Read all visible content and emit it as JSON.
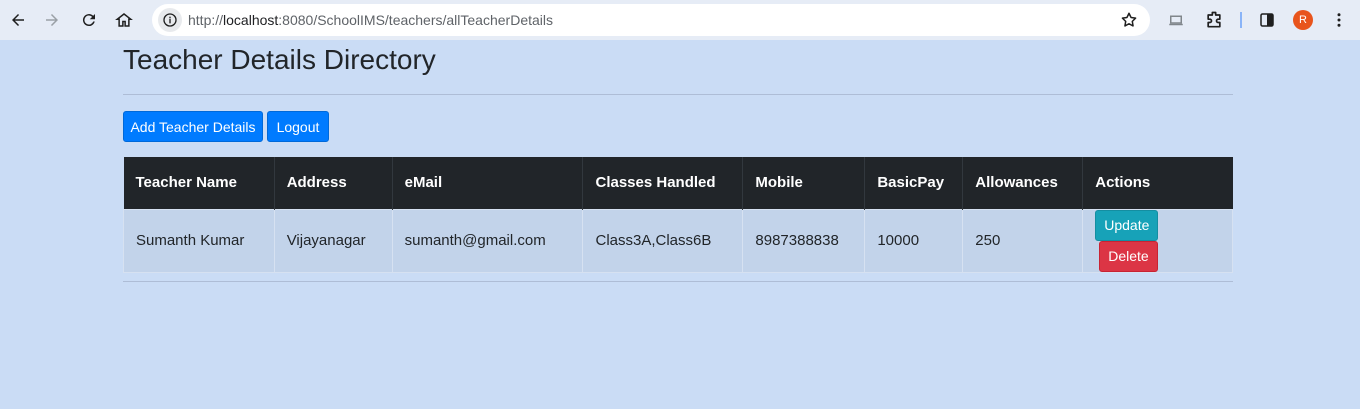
{
  "browser": {
    "url_prefix": "http://",
    "url_host": "localhost",
    "url_rest": ":8080/SchoolIMS/teachers/allTeacherDetails",
    "profile_initial": "R",
    "accent_color": "#e8541c"
  },
  "page": {
    "title": "Teacher Details Directory",
    "buttons": {
      "add_label": "Add Teacher Details",
      "logout_label": "Logout"
    },
    "table": {
      "headers": [
        "Teacher Name",
        "Address",
        "eMail",
        "Classes Handled",
        "Mobile",
        "BasicPay",
        "Allowances",
        "Actions"
      ],
      "rows": [
        {
          "name": "Sumanth Kumar",
          "address": "Vijayanagar",
          "email": "sumanth@gmail.com",
          "classes": "Class3A,Class6B",
          "mobile": "8987388838",
          "basic_pay": "10000",
          "allowances": "250",
          "update_label": "Update",
          "delete_label": "Delete"
        }
      ]
    }
  },
  "colors": {
    "primary": "#007bff",
    "info": "#17a2b8",
    "danger": "#dc3545",
    "table_header": "#212529",
    "page_background": "#cadcf5"
  }
}
